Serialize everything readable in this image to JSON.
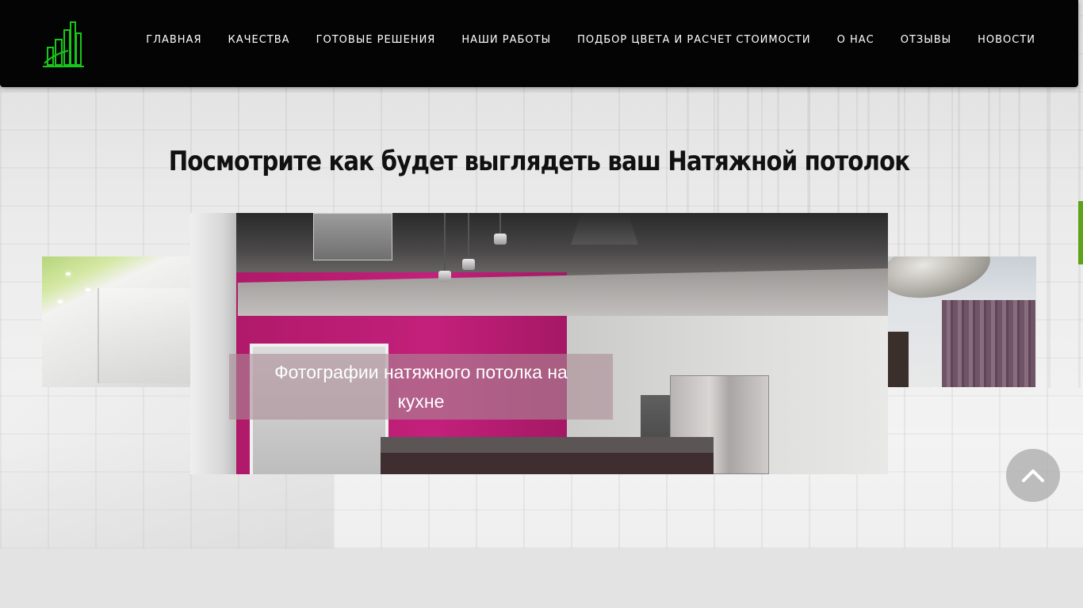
{
  "nav": {
    "items": [
      {
        "label": "ГЛАВНАЯ"
      },
      {
        "label": "КАЧЕСТВА"
      },
      {
        "label": "ГОТОВЫЕ РЕШЕНИЯ"
      },
      {
        "label": "НАШИ РАБОТЫ"
      },
      {
        "label": "ПОДБОР ЦВЕТА И РАСЧЕТ СТОИМОСТИ"
      },
      {
        "label": "О НАС"
      },
      {
        "label": "ОТЗЫВЫ"
      },
      {
        "label": "НОВОСТИ"
      }
    ]
  },
  "section": {
    "title": "Посмотрите как будет выглядеть ваш Натяжной потолок"
  },
  "carousel": {
    "active_caption": "Фотографии натяжного потолка на кухне"
  },
  "icons": {
    "logo": "city-buildings-logo",
    "back_to_top": "chevron-up-icon"
  },
  "colors": {
    "header_bg": "#030403",
    "accent_green": "#5ea21a",
    "logo_green": "#19c61b"
  }
}
